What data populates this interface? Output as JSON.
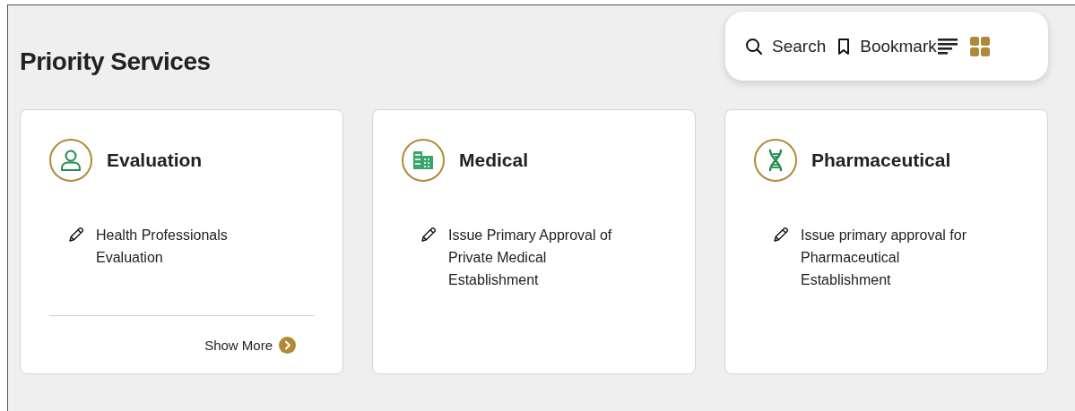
{
  "title": "Priority Services",
  "toolbar": {
    "search": "Search",
    "bookmark": "Bookmark",
    "views": [
      {
        "kind": "list",
        "selected": false
      },
      {
        "kind": "grid",
        "selected": true
      }
    ]
  },
  "cards": [
    {
      "kind": "person",
      "title": "Evaluation",
      "services": [
        "Health Professionals Evaluation"
      ],
      "show_more": "Show More"
    },
    {
      "kind": "building",
      "title": "Medical",
      "services": [
        "Issue Primary Approval of Private Medical Establishment"
      ]
    },
    {
      "kind": "dna",
      "title": "Pharmaceutical",
      "services": [
        "Issue primary approval for Pharmaceutical Establishment"
      ]
    }
  ]
}
